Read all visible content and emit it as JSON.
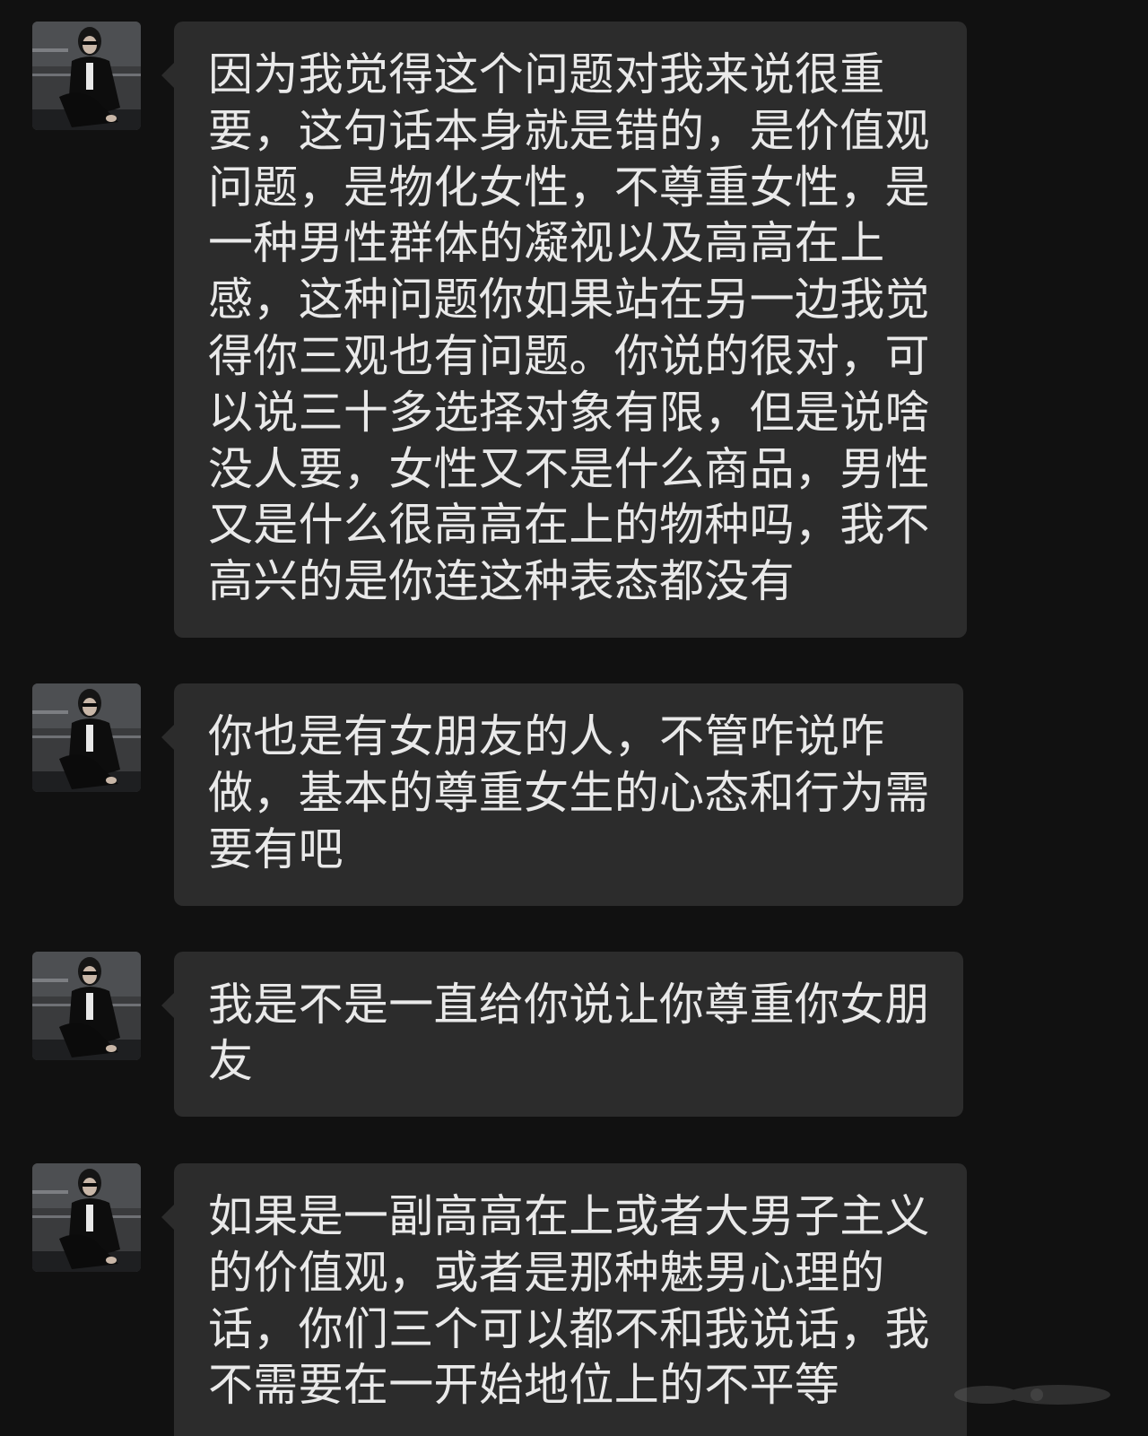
{
  "conversation": {
    "messages": [
      {
        "sender": "contact",
        "avatar_icon": "avatar-person-sunglasses",
        "text": "因为我觉得这个问题对我来说很重要，这句话本身就是错的，是价值观问题，是物化女性，不尊重女性，是一种男性群体的凝视以及高高在上感，这种问题你如果站在另一边我觉得你三观也有问题。你说的很对，可以说三十多选择对象有限，但是说啥没人要，女性又不是什么商品，男性又是什么很高高在上的物种吗，我不高兴的是你连这种表态都没有"
      },
      {
        "sender": "contact",
        "avatar_icon": "avatar-person-sunglasses",
        "text": "你也是有女朋友的人，不管咋说咋做，基本的尊重女生的心态和行为需要有吧"
      },
      {
        "sender": "contact",
        "avatar_icon": "avatar-person-sunglasses",
        "text": "我是不是一直给你说让你尊重你女朋友"
      },
      {
        "sender": "contact",
        "avatar_icon": "avatar-person-sunglasses",
        "text": "如果是一副高高在上或者大男子主义的价值观，或者是那种魅男心理的话，你们三个可以都不和我说话，我不需要在一开始地位上的不平等"
      }
    ]
  },
  "colors": {
    "background": "#111111",
    "bubble": "#2c2c2c",
    "text": "#e9e9e9"
  }
}
